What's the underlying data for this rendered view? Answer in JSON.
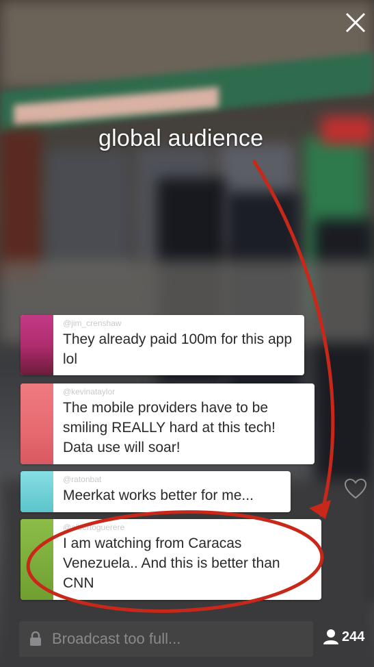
{
  "broadcast": {
    "caption": "global audience",
    "viewer_count": "244",
    "chat_placeholder": "Broadcast too full..."
  },
  "comments": [
    {
      "handle": "@jim_crenshaw",
      "text": "They already paid 100m for this app lol",
      "avatar_color": "#b8347a"
    },
    {
      "handle": "@kevinataylor",
      "text": "The mobile providers  have to be smiling REALLY hard at this tech! Data use will soar!",
      "avatar_color": "#e8747a"
    },
    {
      "handle": "@ratonbat",
      "text": "Meerkat works better for me...",
      "avatar_color": "#6fd0d6"
    },
    {
      "handle": "@albertoguerere",
      "text": "I am watching from Caracas Venezuela.. And this is better than CNN",
      "avatar_color": "#7dae3a"
    }
  ],
  "icons": [
    "close-icon",
    "lock-icon",
    "user-icon",
    "heart-icon"
  ],
  "annotation_color": "#c8281a"
}
